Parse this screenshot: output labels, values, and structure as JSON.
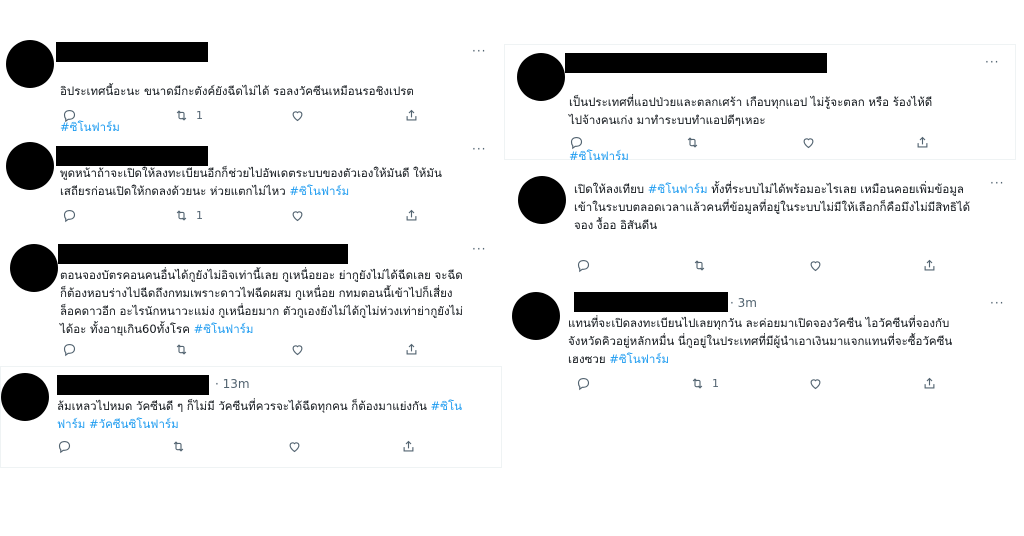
{
  "tweets": [
    {
      "text": "อิประเทศนี้อะนะ ขนาดมีกะตังค์ยังฉีดไม่ได้ รอลงวัคซีนเหมือนรอชิงเปรต",
      "hashtag_line": "#ซิโนฟาร์ม",
      "retweets": "1",
      "time": ""
    },
    {
      "text": "พูดหน้าถ้าจะเปิดให้ลงทะเบียนอีกก็ช่วยไปอัพเดตระบบของตัวเองให้มันดี ให้มัน\nเสถียรก่อนเปิดให้กดลงด้วยนะ ห่วยแตกไม่ไหว",
      "hashtag_line": "#ซิโนฟาร์ม",
      "retweets": "1",
      "time": ""
    },
    {
      "text": "ตอนจองบัตรคอนคนอื่นได้กูยังไม่อิจเท่านี้เลย กูเหนื่อยอะ ย่ากูยังไม่ได้ฉีดเลย จะฉีด\nก็ต้องหอบร่างไปฉีดถึงกทมเพราะดาวไฟฉีดผสม กูเหนื่อย กทมตอนนี้เข้าไปก็เสี่ยง\nล็อคดาวอีก อะไรนักหนาวะแม่ง กูเหนื่อยมาก ตัวกูเองยังไม่ได้กูไม่ห่วงเท่าย่ากูยังไม่\nได้อะ ทั้งอายุเกิน60ทั้งโรค",
      "hashtag_line": "#ซิโนฟาร์ม",
      "retweets": "",
      "time": ""
    },
    {
      "text": "ล้มเหลวไปหมด วัคซีนดี ๆ ก็ไม่มี วัคซีนที่ควรจะได้ฉีดทุกคน ก็ต้องมาแย่งกัน",
      "hashtag_line": "#ซิโน\nฟาร์ม #วัคซีนซิโนฟาร์ม",
      "retweets": "",
      "time": "· 13m"
    },
    {
      "text": "เป็นประเทศที่แอปป่วยและตลกเศร้า เกือบทุกแอป ไม่รู้จะตลก หรือ ร้องไห้ดี\nไปจ้างคนเก่ง มาทำระบบทำแอปดีๆเหอะ",
      "hashtag_line": "#ซิโนฟาร์ม",
      "retweets": "",
      "time": ""
    },
    {
      "text": "เปิดให้ลงเทียบ",
      "hashtag_line": "#ซิโนฟาร์ม",
      "text_after": "ทั้งที่ระบบไม่ได้พร้อมอะไรเลย เหมือนคอยเพิ่มข้อมูล\nเข้าในระบบตลอดเวลาแล้วคนที่ข้อมูลที่อยู่ในระบบไม่มีให้เลือกก็คือมึงไม่มีสิทธิได้\nจอง งื้ออ อิสันดีน",
      "retweets": "",
      "time": ""
    },
    {
      "text": "แทนที่จะเปิดลงทะเบียนไปเลยทุกวัน ละค่อยมาเปิดจองวัคซีน ไอวัคซีนที่จองกับ\nจังหวัดคิวอยู่หลักหมื่น นี่กูอยู่ในประเทศที่มีผู้นำเอาเงินมาแจกแทนที่จะซื้อวัคซีน\nเฮงซวย",
      "hashtag_line": "#ซิโนฟาร์ม",
      "retweets": "1",
      "time": "· 3m"
    }
  ],
  "ui": {
    "more": "···",
    "icons": [
      "reply-icon",
      "retweet-icon",
      "like-icon",
      "share-icon"
    ]
  }
}
